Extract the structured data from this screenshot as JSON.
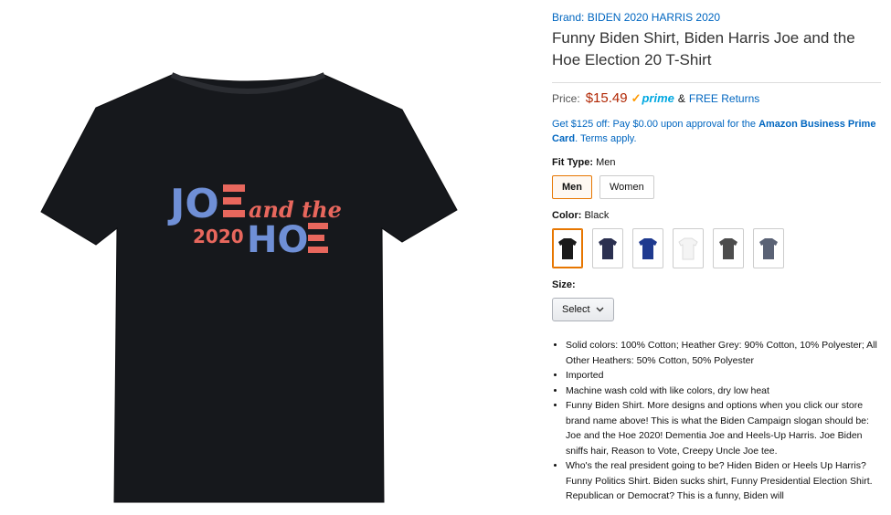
{
  "brand": "Brand: BIDEN 2020 HARRIS 2020",
  "title": "Funny Biden Shirt, Biden Harris Joe and the Hoe Election 20 T-Shirt",
  "price": {
    "label": "Price:",
    "value": "$15.49",
    "prime_check": "✓",
    "prime": "prime",
    "amp": "&",
    "free_returns": "FREE Returns"
  },
  "promo": {
    "text": "Get $125 off: Pay $0.00 upon approval for the ",
    "bold": "Amazon Business Prime Card",
    "end": ". Terms apply."
  },
  "fit": {
    "label": "Fit Type:",
    "value": "Men",
    "options": [
      "Men",
      "Women"
    ]
  },
  "color": {
    "label": "Color:",
    "value": "Black",
    "swatches": [
      "#1a1a1a",
      "#2b3050",
      "#1f3a8f",
      "#f4f4f4",
      "#4d4d4d",
      "#5a6275"
    ]
  },
  "size": {
    "label": "Size:",
    "select_label": "Select"
  },
  "shirt": {
    "color": "#16181c",
    "line1_joe": "JO",
    "line1_and": "and the",
    "line2_year": "2020",
    "line2_ho": "HO",
    "blue": "#6f8fd6",
    "red": "#e8675d"
  },
  "bullets": [
    "Solid colors: 100% Cotton; Heather Grey: 90% Cotton, 10% Polyester; All Other Heathers: 50% Cotton, 50% Polyester",
    "Imported",
    "Machine wash cold with like colors, dry low heat",
    "Funny Biden Shirt. More designs and options when you click our store brand name above! This is what the Biden Campaign slogan should be: Joe and the Hoe 2020! Dementia Joe and Heels-Up Harris. Joe Biden sniffs hair, Reason to Vote, Creepy Uncle Joe tee.",
    "Who's the real president going to be? Hiden Biden or Heels Up Harris? Funny Politics Shirt. Biden sucks shirt, Funny Presidential Election Shirt. Republican or Democrat? This is a funny, Biden will"
  ]
}
